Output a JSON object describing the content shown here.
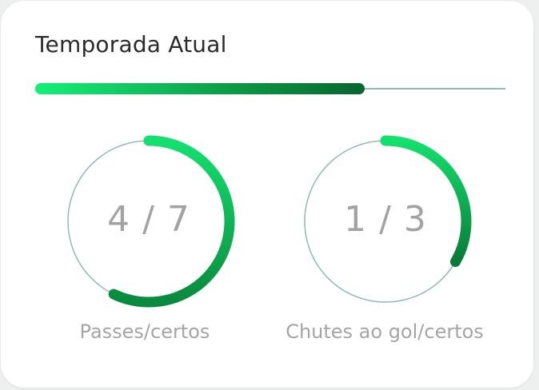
{
  "card": {
    "title": "Temporada Atual",
    "season_progress": 0.7
  },
  "stats": [
    {
      "value": "4 / 7",
      "label": "Passes/certos",
      "completed": 4,
      "total": 7
    },
    {
      "value": "1 / 3",
      "label": "Chutes ao gol/certos",
      "completed": 1,
      "total": 3
    }
  ],
  "colors": {
    "accent_start": "#14f07a",
    "accent_mid": "#0c9a45",
    "accent_end": "#08652f",
    "track": "#8fbcb4",
    "value_text": "#a3a3a3",
    "label_text": "#a5a5a5",
    "title_text": "#2b2b2b"
  }
}
